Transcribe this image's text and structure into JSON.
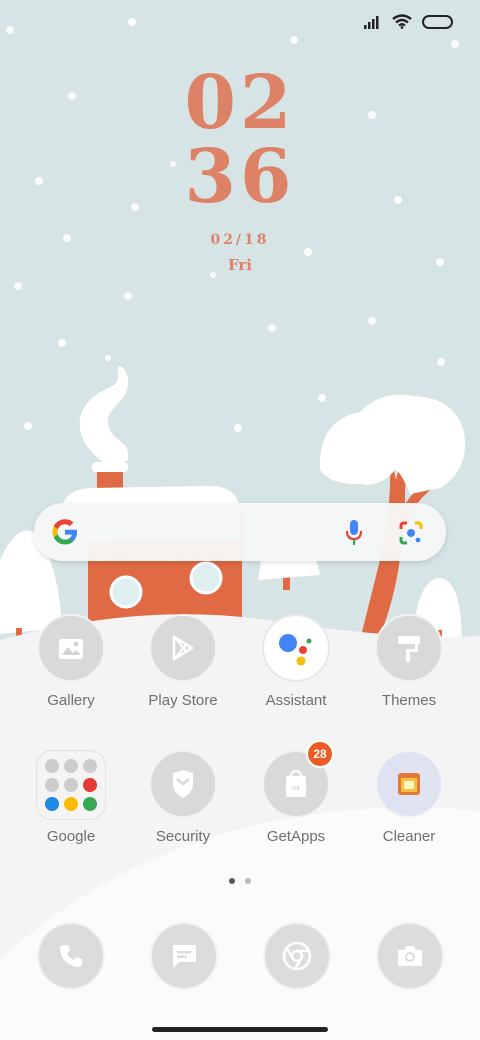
{
  "status_bar": {
    "icons": [
      "signal-icon",
      "wifi-icon",
      "battery-icon"
    ]
  },
  "clock": {
    "hour": "02",
    "minute": "36",
    "date": "02/18",
    "day": "Fri",
    "color": "#dd8266"
  },
  "search_bar": {
    "logo": "google-g-icon",
    "voice_icon": "microphone-icon",
    "lens_icon": "lens-camera-icon"
  },
  "apps_row1": [
    {
      "label": "Gallery",
      "icon": "gallery-icon"
    },
    {
      "label": "Play Store",
      "icon": "play-store-icon"
    },
    {
      "label": "Assistant",
      "icon": "assistant-icon"
    },
    {
      "label": "Themes",
      "icon": "themes-icon"
    }
  ],
  "apps_row2": [
    {
      "label": "Google",
      "icon": "google-folder-icon"
    },
    {
      "label": "Security",
      "icon": "security-icon"
    },
    {
      "label": "GetApps",
      "icon": "getapps-icon",
      "badge": "28"
    },
    {
      "label": "Cleaner",
      "icon": "cleaner-icon"
    }
  ],
  "page_indicator": {
    "pages": 2,
    "active": 1
  },
  "dock": [
    {
      "icon": "phone-icon"
    },
    {
      "icon": "messages-icon"
    },
    {
      "icon": "chrome-icon"
    },
    {
      "icon": "camera-icon"
    }
  ],
  "colors": {
    "accent": "#dd8266",
    "house": "#e06a44",
    "sky": "#d6e4e6",
    "badge": "#ee5a24"
  }
}
